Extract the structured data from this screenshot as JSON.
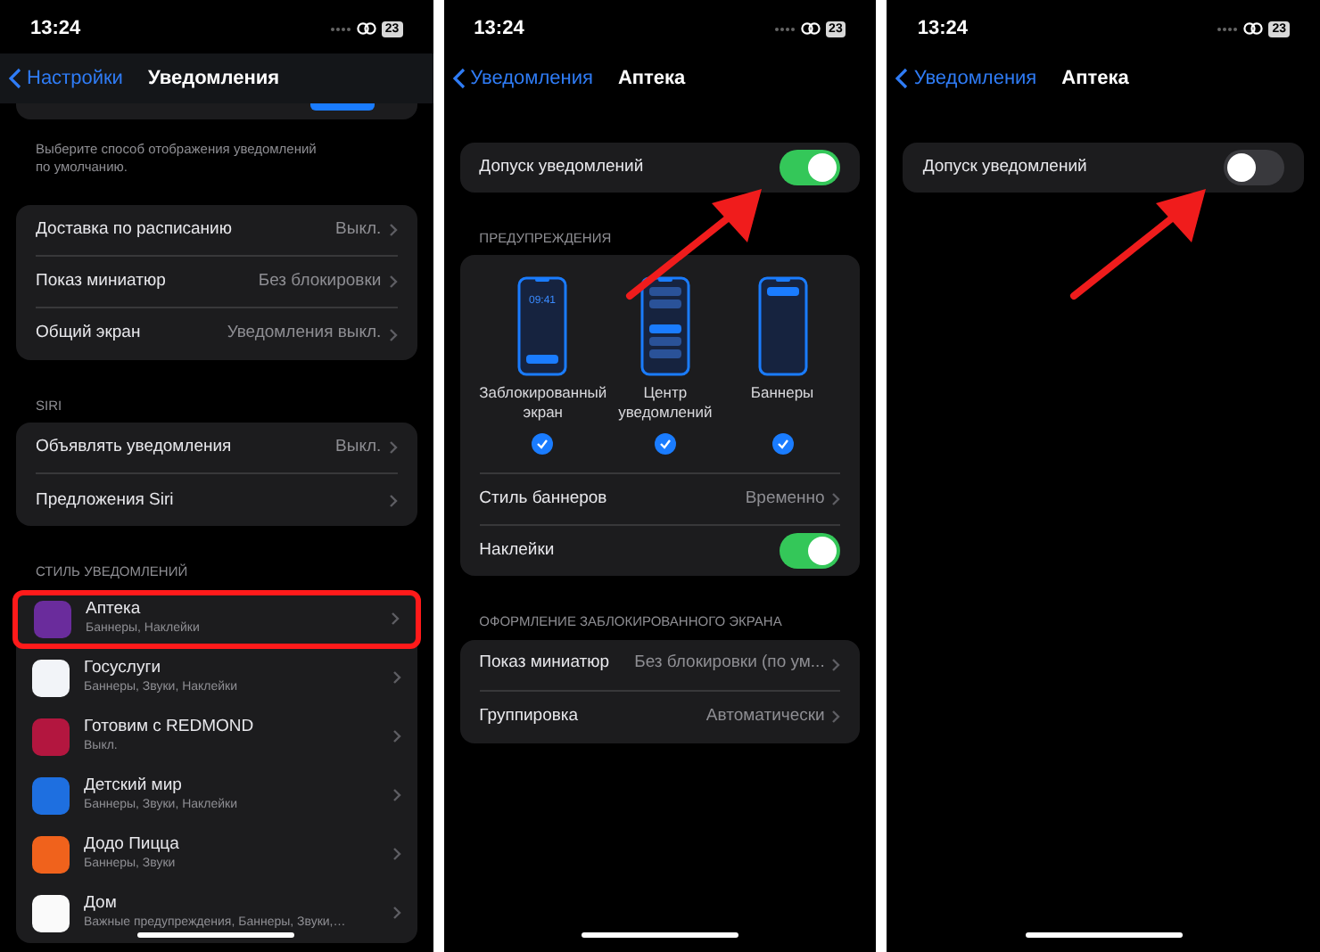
{
  "panels": [
    {
      "status": {
        "time": "13:24",
        "battery": "23"
      },
      "nav": {
        "back": "Настройки",
        "title": "Уведомления"
      },
      "sections": [
        {
          "kind": "cut_card"
        },
        {
          "kind": "note",
          "text": "Выберите способ отображения уведомлений по умолчанию."
        },
        {
          "kind": "card",
          "rows": [
            {
              "kind": "value",
              "label": "Доставка по расписанию",
              "value": "Выкл."
            },
            {
              "kind": "value",
              "label": "Показ миниатюр",
              "value": "Без блокировки"
            },
            {
              "kind": "value",
              "label": "Общий экран",
              "value": "Уведомления выкл."
            }
          ]
        },
        {
          "kind": "header",
          "text": "SIRI"
        },
        {
          "kind": "card",
          "rows": [
            {
              "kind": "value",
              "label": "Объявлять уведомления",
              "value": "Выкл."
            },
            {
              "kind": "value",
              "label": "Предложения Siri"
            }
          ]
        },
        {
          "kind": "header",
          "text": "СТИЛЬ УВЕДОМЛЕНИЙ"
        },
        {
          "kind": "card",
          "rows": [
            {
              "kind": "app",
              "label": "Аптека",
              "value": "Баннеры, Наклейки",
              "color": "#6a2c9c",
              "selected": true
            },
            {
              "kind": "app",
              "label": "Госуслуги",
              "value": "Баннеры, Звуки, Наклейки",
              "color": "#f2f4f8",
              "selected": false
            },
            {
              "kind": "app",
              "label": "Готовим с REDMOND",
              "value": "Выкл.",
              "color": "#b3163f",
              "selected": false
            },
            {
              "kind": "app",
              "label": "Детский мир",
              "value": "Баннеры, Звуки, Наклейки",
              "color": "#1e6fe0",
              "selected": false
            },
            {
              "kind": "app",
              "label": "Додо Пицца",
              "value": "Баннеры, Звуки",
              "color": "#f0621c",
              "selected": false
            },
            {
              "kind": "app",
              "label": "Дом",
              "value": "Важные предупреждения, Баннеры, Звуки,…",
              "color": "#fafafa",
              "selected": false
            }
          ]
        }
      ]
    },
    {
      "status": {
        "time": "13:24",
        "battery": "23"
      },
      "nav": {
        "back": "Уведомления",
        "title": "Аптека"
      },
      "sections": [
        {
          "kind": "card",
          "rows": [
            {
              "kind": "toggle",
              "label": "Допуск уведомлений",
              "on": true,
              "arrow": true
            }
          ]
        },
        {
          "kind": "header",
          "text": "ПРЕДУПРЕЖДЕНИЯ"
        },
        {
          "kind": "card",
          "rows": [
            {
              "kind": "styles",
              "options": [
                {
                  "kind": "lock",
                  "clock": "09:41",
                  "label": "Заблокированный экран",
                  "checked": true
                },
                {
                  "kind": "center",
                  "label": "Центр уведомлений",
                  "checked": true
                },
                {
                  "kind": "banners",
                  "label": "Баннеры",
                  "checked": true
                }
              ]
            },
            {
              "kind": "value",
              "label": "Стиль баннеров",
              "value": "Временно"
            },
            {
              "kind": "toggle",
              "label": "Наклейки",
              "on": true,
              "arrow": false
            }
          ]
        },
        {
          "kind": "header",
          "text": "ОФОРМЛЕНИЕ ЗАБЛОКИРОВАННОГО ЭКРАНА"
        },
        {
          "kind": "card",
          "rows": [
            {
              "kind": "value",
              "label": "Показ миниатюр",
              "value": "Без блокировки (по ум..."
            },
            {
              "kind": "value",
              "label": "Группировка",
              "value": "Автоматически"
            }
          ]
        }
      ]
    },
    {
      "status": {
        "time": "13:24",
        "battery": "23"
      },
      "nav": {
        "back": "Уведомления",
        "title": "Аптека"
      },
      "sections": [
        {
          "kind": "card",
          "rows": [
            {
              "kind": "toggle",
              "label": "Допуск уведомлений",
              "on": false,
              "arrow": true
            }
          ]
        }
      ]
    }
  ]
}
